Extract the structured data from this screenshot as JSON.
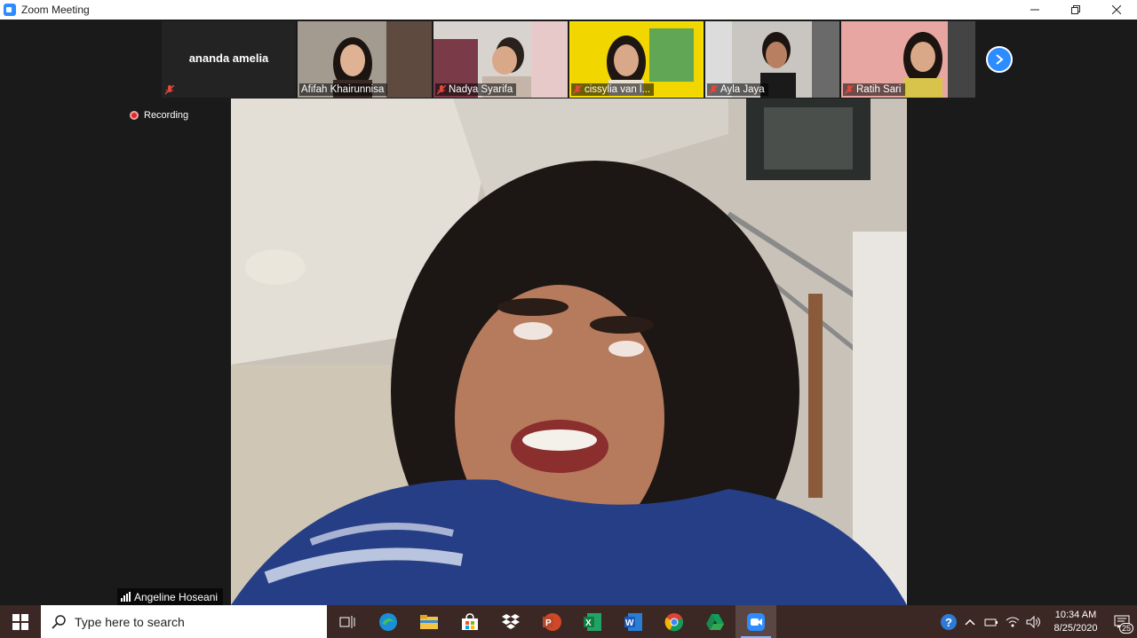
{
  "window": {
    "title": "Zoom Meeting",
    "controls": [
      "minimize",
      "restore",
      "close"
    ]
  },
  "strip": {
    "tiles": [
      {
        "name": "ananda amelia",
        "muted": true,
        "video": false
      },
      {
        "name": "Afifah Khairunnisa",
        "muted": false,
        "video": true
      },
      {
        "name": "Nadya Syarifa",
        "muted": true,
        "video": true
      },
      {
        "name": "cissylia van l...",
        "muted": true,
        "video": true
      },
      {
        "name": "Ayla Jaya",
        "muted": true,
        "video": true
      },
      {
        "name": "Ratih Sari",
        "muted": true,
        "video": true
      }
    ],
    "next_icon": "chevron-right-icon"
  },
  "recording": {
    "label": "Recording"
  },
  "speaker": {
    "name": "Angeline Hoseani"
  },
  "taskbar": {
    "search_placeholder": "Type here to search",
    "apps": [
      "task-view",
      "edge",
      "file-explorer",
      "store",
      "dropbox",
      "powerpoint",
      "excel",
      "word",
      "chrome",
      "google-drive",
      "zoom"
    ],
    "time": "10:34 AM",
    "date": "8/25/2020",
    "notification_count": "25"
  },
  "colors": {
    "accent": "#2d8cff",
    "taskbar": "#3b2723",
    "recording": "#e02828",
    "muted": "#e0483e"
  }
}
